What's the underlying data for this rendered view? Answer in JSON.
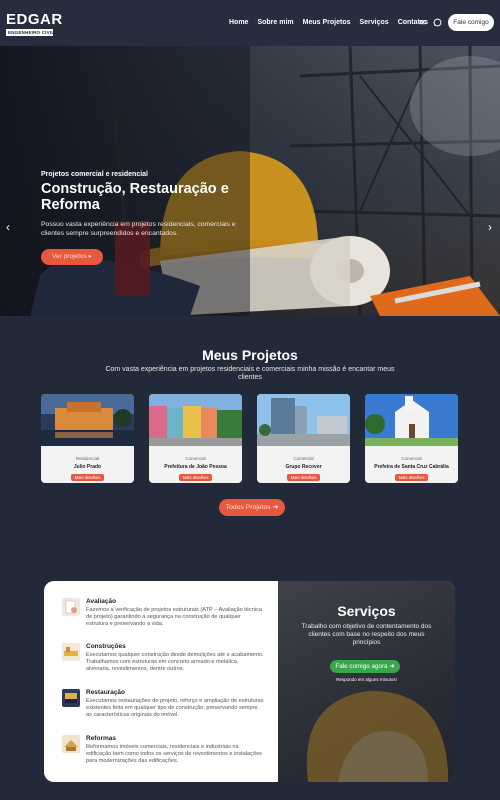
{
  "nav": {
    "logo_name": "EDGAR",
    "logo_sub": "ENGENHEIRO CIVIL",
    "menu": [
      "Home",
      "Sobre mim",
      "Meus Projetos",
      "Serviços",
      "Contatos"
    ],
    "mail_icon": "✉",
    "whatsapp_icon": "◯",
    "cta": "Fale comigo"
  },
  "hero": {
    "kicker": "Projetos comercial e residencial",
    "title": "Construção, Restauração e Reforma",
    "text": "Possuo vasta experiência em projetos residenciais, comerciais e clientes sempre surpreendidos e encantados.",
    "button": "Ver projetos ▸",
    "prev": "‹",
    "next": "›"
  },
  "projects": {
    "title": "Meus Projetos",
    "subtitle": "Com vasta experiência em projetos residenciais e comerciais minha missão é encantar meus clientes",
    "details_label": "Mais detalhes",
    "items": [
      {
        "category": "Residencial",
        "name": "Julio Prado"
      },
      {
        "category": "Comercial",
        "name": "Prefeitura de João Pessoa"
      },
      {
        "category": "Comercial",
        "name": "Grupo Recover"
      },
      {
        "category": "Comercial",
        "name": "Prefeira de Santa Cruz Cabrália"
      }
    ],
    "all_button": "Todos Projetos ➜"
  },
  "services": {
    "title": "Serviços",
    "text": "Trabalho com objetivo de contentamento dos clientes com base no respeito dos meus princípios",
    "button": "Fale comigo agora ➜",
    "note": "Respondo em alguns minutos!",
    "items": [
      {
        "title": "Avaliação",
        "text": "Fazemos a verificação de projetos estruturais (ATP – Avaliação técnica de projeto) garantindo a segurança na construção de qualquer estrutura e preservando a vida."
      },
      {
        "title": "Construções",
        "text": "Executamos qualquer construção desde demolições até o acabamento. Trabalhamos com estruturas em concreto armado e metálica, alvenaria, revestimentos, dentre outros."
      },
      {
        "title": "Restauração",
        "text": "Executamos restaurações de projeto, reforço e ampliação de estruturas existentes feita em qualquer tipo de construção, preservando sempre as características originais do imóvel."
      },
      {
        "title": "Reformas",
        "text": "Reformamos imóveis comerciais, residenciais e industriais na edificação bem como todos os serviços de revestimentos e instalações para modernizações das edificações."
      }
    ]
  },
  "colors": {
    "accent": "#e8573e",
    "background": "#222a3a",
    "whatsapp": "#3aa64a"
  }
}
